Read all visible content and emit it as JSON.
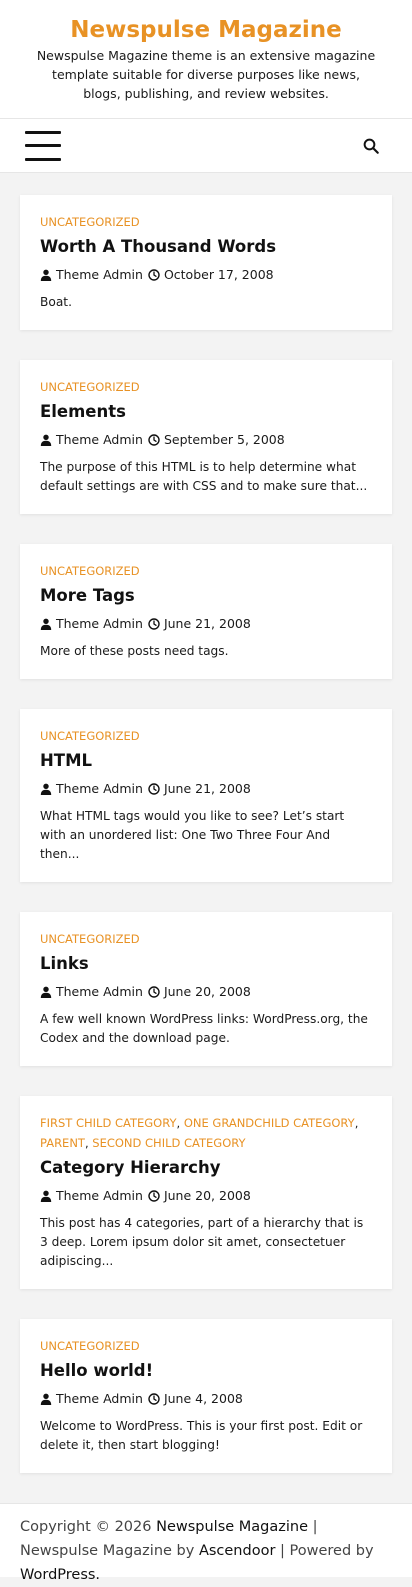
{
  "header": {
    "title": "Newspulse Magazine",
    "description": "Newspulse Magazine theme is an extensive magazine template suitable for diverse purposes like news, blogs, publishing, and review websites."
  },
  "nav": {
    "menu_icon": "hamburger-menu-icon",
    "search_icon": "search-icon"
  },
  "posts": [
    {
      "categories": [
        "UNCATEGORIZED"
      ],
      "title": "Worth A Thousand Words",
      "author": "Theme Admin",
      "date": "October 17, 2008",
      "excerpt": "Boat."
    },
    {
      "categories": [
        "UNCATEGORIZED"
      ],
      "title": "Elements",
      "author": "Theme Admin",
      "date": "September 5, 2008",
      "excerpt": "The purpose of this HTML is to help determine what default settings are with CSS and to make sure that..."
    },
    {
      "categories": [
        "UNCATEGORIZED"
      ],
      "title": "More Tags",
      "author": "Theme Admin",
      "date": "June 21, 2008",
      "excerpt": "More of these posts need tags."
    },
    {
      "categories": [
        "UNCATEGORIZED"
      ],
      "title": "HTML",
      "author": "Theme Admin",
      "date": "June 21, 2008",
      "excerpt": "What HTML tags would you like to see? Let’s start with an unordered list: One Two Three Four And then..."
    },
    {
      "categories": [
        "UNCATEGORIZED"
      ],
      "title": "Links",
      "author": "Theme Admin",
      "date": "June 20, 2008",
      "excerpt": "A few well known WordPress links: WordPress.org, the Codex and the download page."
    },
    {
      "categories": [
        "FIRST CHILD CATEGORY",
        "ONE GRANDCHILD CATEGORY",
        "PARENT",
        "SECOND CHILD CATEGORY"
      ],
      "title": "Category Hierarchy",
      "author": "Theme Admin",
      "date": "June 20, 2008",
      "excerpt": "This post has 4 categories, part of a hierarchy that is 3 deep. Lorem ipsum dolor sit amet, consectetuer adipiscing..."
    },
    {
      "categories": [
        "UNCATEGORIZED"
      ],
      "title": "Hello world!",
      "author": "Theme Admin",
      "date": "June 4, 2008",
      "excerpt": "Welcome to WordPress. This is your first post. Edit or delete it, then start blogging!"
    }
  ],
  "footer": {
    "copyright": "Copyright © 2026",
    "site_link": "Newspulse Magazine",
    "sep1": "|",
    "theme_text": "Newspulse Magazine by",
    "author_link": "Ascendoor",
    "sep2": "|",
    "powered_text": "Powered by",
    "wp_link": "WordPress."
  },
  "colors": {
    "accent": "#e89225",
    "background": "#f3f3f3",
    "card": "#ffffff"
  }
}
